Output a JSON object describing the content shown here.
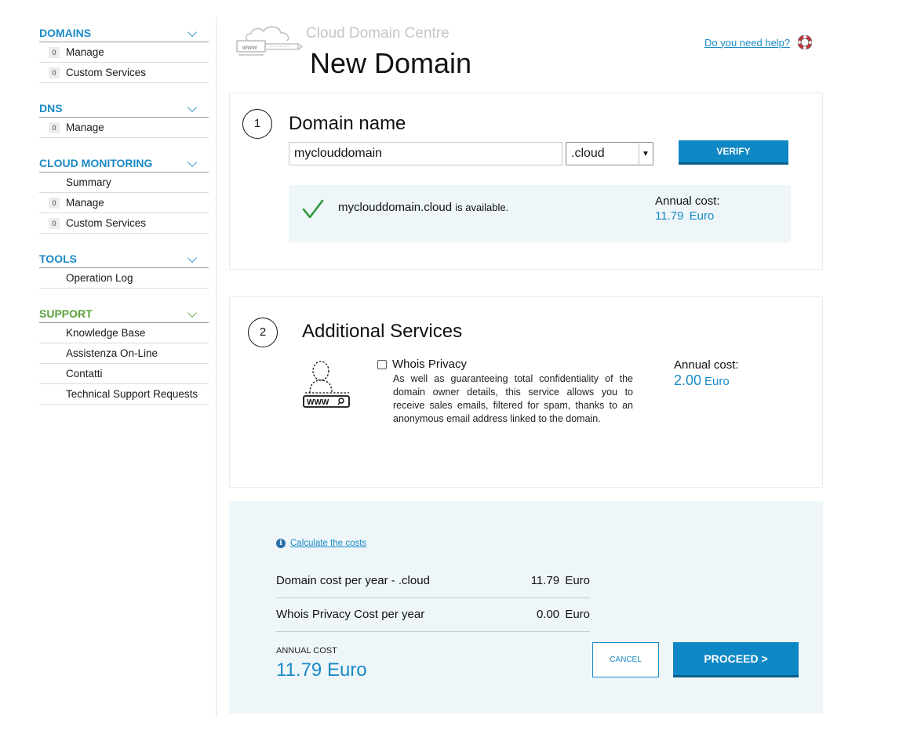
{
  "sidebar": {
    "sections": [
      {
        "title": "DOMAINS",
        "color": "#1a8ac6",
        "items": [
          {
            "label": "Manage",
            "badge": "0"
          },
          {
            "label": "Custom Services",
            "badge": "0"
          }
        ]
      },
      {
        "title": "DNS",
        "color": "#1a8ac6",
        "items": [
          {
            "label": "Manage",
            "badge": "0"
          }
        ]
      },
      {
        "title": "CLOUD MONITORING",
        "color": "#1a8ac6",
        "items": [
          {
            "label": "Summary",
            "badge": null
          },
          {
            "label": "Manage",
            "badge": "0"
          },
          {
            "label": "Custom Services",
            "badge": "0"
          }
        ]
      },
      {
        "title": "TOOLS",
        "color": "#1a8ac6",
        "items": [
          {
            "label": "Operation Log",
            "badge": null
          }
        ]
      },
      {
        "title": "SUPPORT",
        "color": "#5aa23a",
        "items": [
          {
            "label": "Knowledge Base",
            "badge": null
          },
          {
            "label": "Assistenza On-Line",
            "badge": null
          },
          {
            "label": "Contatti",
            "badge": null
          },
          {
            "label": "Technical Support Requests",
            "badge": null
          }
        ]
      }
    ]
  },
  "header": {
    "brand": "Cloud Domain Centre",
    "title": "New Domain",
    "help_link": "Do you need help?",
    "logo_icon": "www-cloud-icon",
    "help_icon": "lifebuoy-icon"
  },
  "step1": {
    "number": "1",
    "title": "Domain name",
    "domain_value": "myclouddomain",
    "tld_selected": ".cloud",
    "verify_label": "VERIFY",
    "availability": {
      "domain": "myclouddomain.cloud",
      "status": "is available.",
      "cost_label": "Annual cost:",
      "cost_value": "11.79",
      "currency": "Euro"
    }
  },
  "step2": {
    "number": "2",
    "title": "Additional Services",
    "service_icon": "whois-privacy-icon",
    "service_name": "Whois Privacy",
    "service_checked": false,
    "service_description": "As well as guaranteeing total confidentiality of the domain owner details, this service allows you to receive sales emails, filtered for spam, thanks to an anonymous email address linked to the domain.",
    "cost_label": "Annual cost:",
    "cost_value": "2.00",
    "currency": "Euro"
  },
  "summary": {
    "calc_link": "Calculate the costs",
    "rows": [
      {
        "label": "Domain cost per year - .cloud",
        "value": "11.79",
        "currency": "Euro"
      },
      {
        "label": "Whois Privacy Cost per year",
        "value": "0.00",
        "currency": "Euro"
      }
    ],
    "annual_label": "ANNUAL COST",
    "annual_value": "11.79 Euro",
    "cancel_label": "CANCEL",
    "proceed_label": "PROCEED >"
  },
  "colors": {
    "accent": "#1a8ac6",
    "button": "#0e88c4",
    "support_green": "#5aa23a",
    "check_green": "#2a9a3a",
    "summary_bg": "#eef6f9"
  }
}
